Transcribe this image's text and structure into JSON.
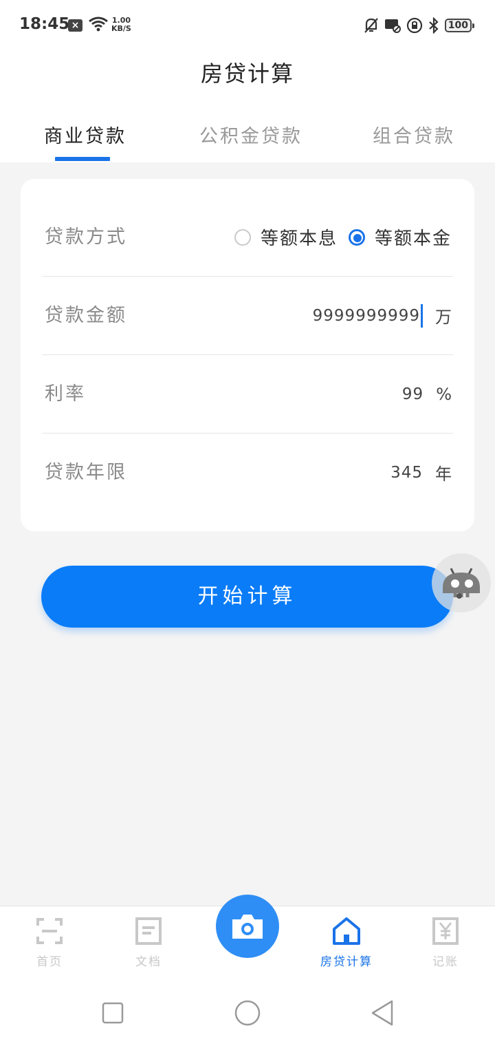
{
  "status_bar": {
    "time": "18:45",
    "net_speed_value": "1.00",
    "net_speed_unit": "KB/S",
    "battery": "100",
    "icons": [
      "close-notification-icon",
      "wifi-icon",
      "bell-muted-icon",
      "message-off-icon",
      "lock-rotation-icon",
      "bluetooth-icon",
      "battery-icon"
    ]
  },
  "header": {
    "title": "房贷计算"
  },
  "tabs": [
    {
      "label": "商业贷款",
      "active": true
    },
    {
      "label": "公积金贷款",
      "active": false
    },
    {
      "label": "组合贷款",
      "active": false
    }
  ],
  "form": {
    "method": {
      "label": "贷款方式",
      "option1": "等额本息",
      "option2": "等额本金",
      "selected": "等额本金"
    },
    "amount": {
      "label": "贷款金额",
      "value": "9999999999",
      "unit": "万"
    },
    "rate": {
      "label": "利率",
      "value": "99",
      "unit": "%"
    },
    "years": {
      "label": "贷款年限",
      "value": "345",
      "unit": "年"
    }
  },
  "actions": {
    "calculate_label": "开始计算"
  },
  "bottom_nav": [
    {
      "label": "首页",
      "icon": "scan-icon",
      "active": false
    },
    {
      "label": "文档",
      "icon": "document-icon",
      "active": false
    },
    {
      "label": "",
      "icon": "camera-icon",
      "active": false
    },
    {
      "label": "房贷计算",
      "icon": "house-icon",
      "active": true
    },
    {
      "label": "记账",
      "icon": "yen-icon",
      "active": false
    }
  ],
  "colors": {
    "accent": "#1a73e8",
    "button": "#0a7cf8",
    "inactive": "#c8c8c8"
  }
}
